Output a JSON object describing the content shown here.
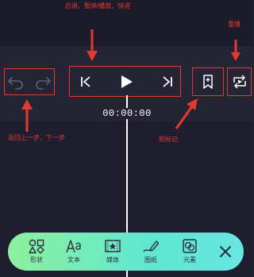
{
  "annotations": {
    "transport_note": "后退、暂停/播放、快进",
    "repeat_note": "重播",
    "undo_note": "返回上一步、下一步",
    "bookmark_note": "侧标记"
  },
  "timeline": {
    "timecode": "00:00:00"
  },
  "toolbar": {
    "shape_label": "形状",
    "text_label": "文本",
    "media_label": "媒体",
    "draw_label": "图纸",
    "element_label": "元素"
  },
  "colors": {
    "annotation_red": "#e23a30",
    "background": "#242334",
    "toolbar_start": "#8ef09e",
    "toolbar_end": "#67e6e0"
  },
  "icons": [
    "undo-icon",
    "redo-icon",
    "skip-back-icon",
    "play-icon",
    "skip-forward-icon",
    "bookmark-icon",
    "repeat-icon",
    "shapes-icon",
    "text-icon",
    "media-icon",
    "draw-icon",
    "element-icon",
    "close-icon"
  ]
}
